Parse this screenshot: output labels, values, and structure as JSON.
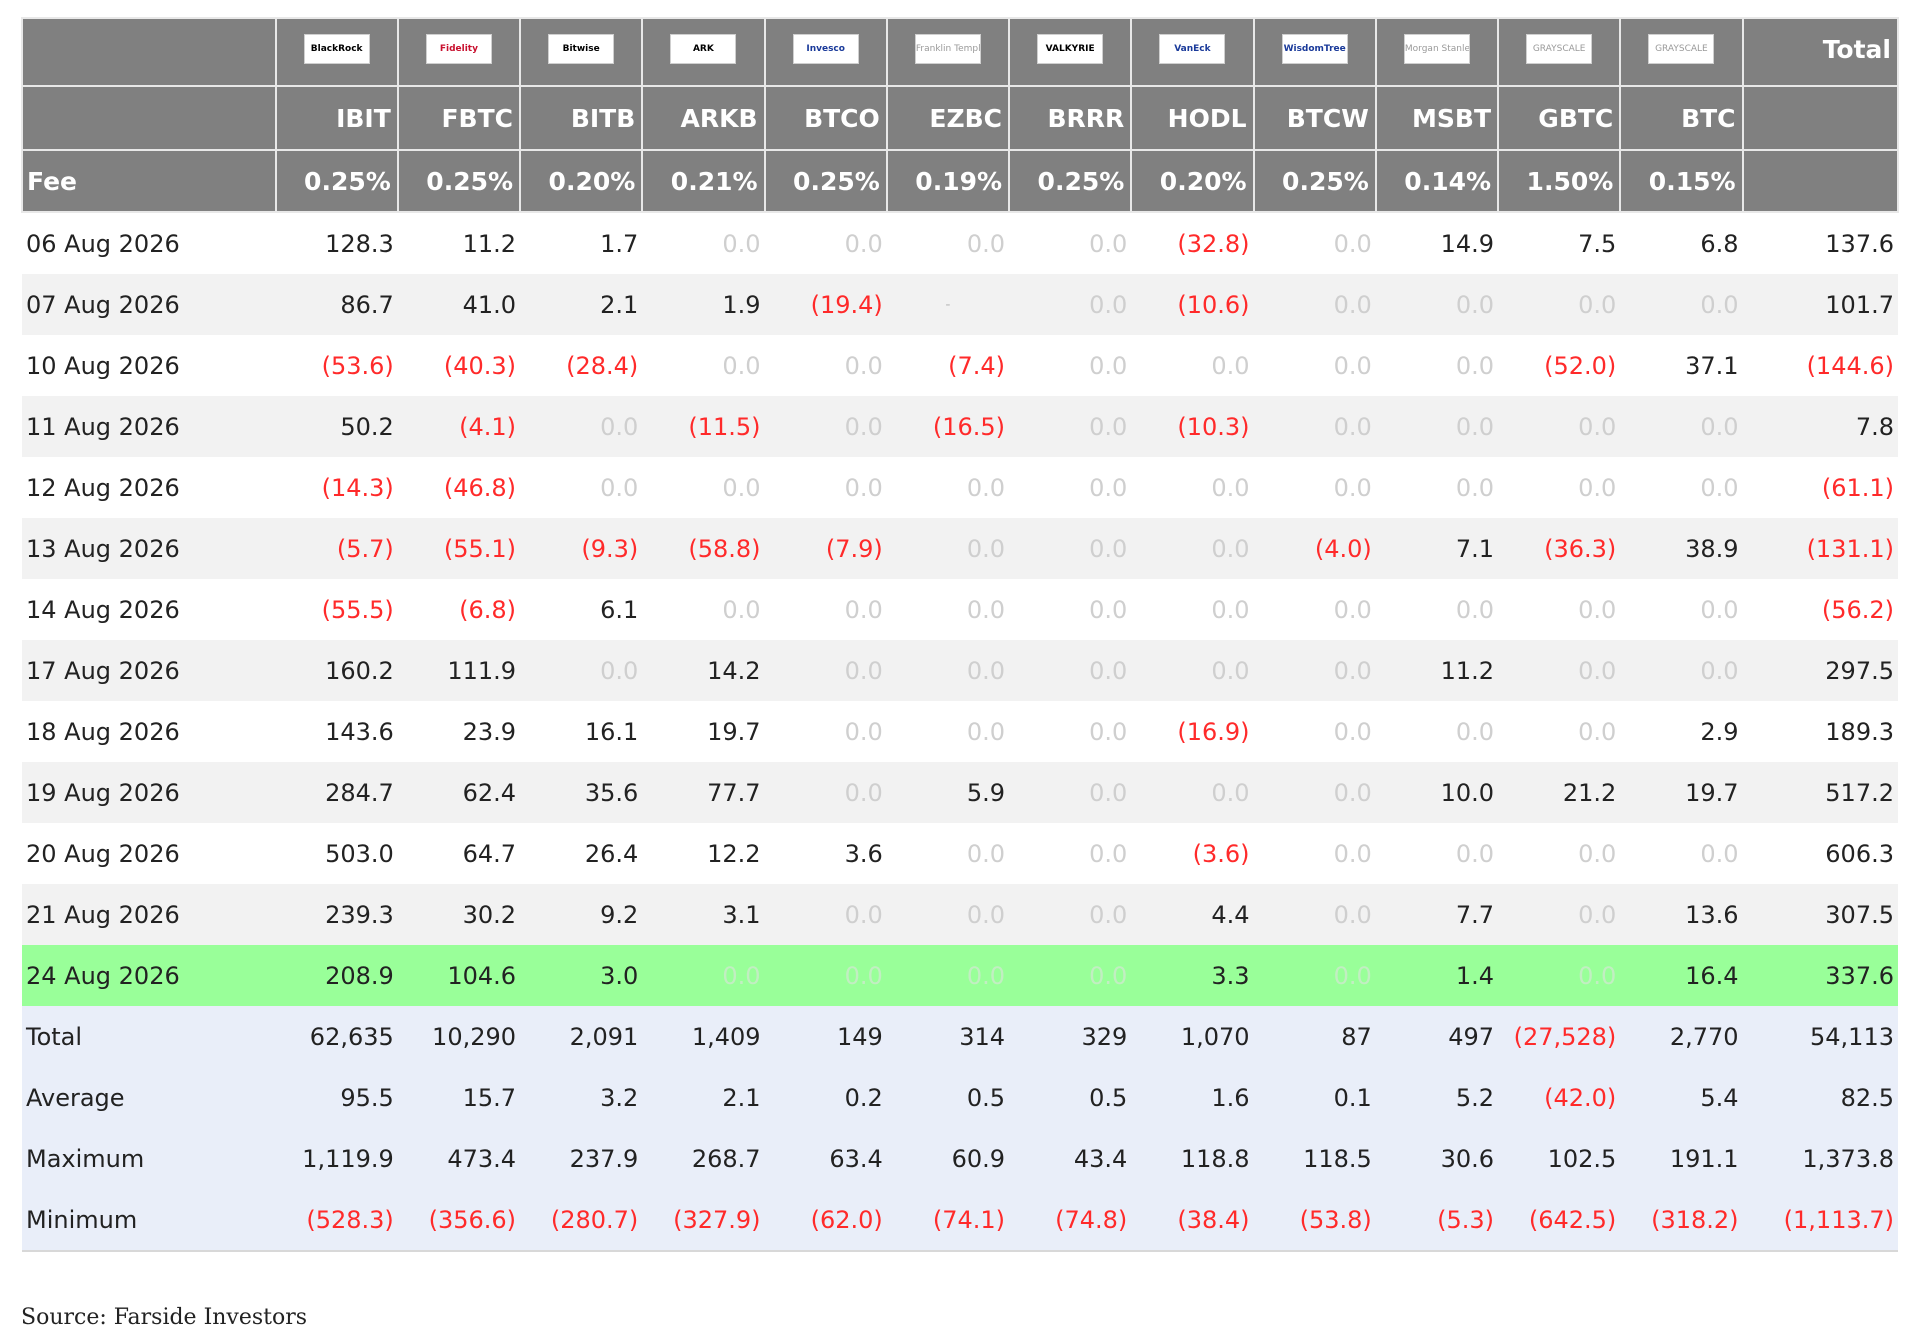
{
  "header": {
    "total_label": "Total",
    "fee_label": "Fee",
    "funds": [
      {
        "ticker": "IBIT",
        "fee": "0.25%",
        "logo_text": "BlackRock",
        "logo_icon": "blackrock-logo"
      },
      {
        "ticker": "FBTC",
        "fee": "0.25%",
        "logo_text": "Fidelity",
        "logo_icon": "fidelity-logo"
      },
      {
        "ticker": "BITB",
        "fee": "0.20%",
        "logo_text": "Bitwise",
        "logo_icon": "bitwise-logo"
      },
      {
        "ticker": "ARKB",
        "fee": "0.21%",
        "logo_text": "ARK",
        "logo_icon": "ark-logo"
      },
      {
        "ticker": "BTCO",
        "fee": "0.25%",
        "logo_text": "Invesco",
        "logo_icon": "invesco-logo"
      },
      {
        "ticker": "EZBC",
        "fee": "0.19%",
        "logo_text": "Franklin Templeton",
        "logo_icon": "franklin-logo"
      },
      {
        "ticker": "BRRR",
        "fee": "0.25%",
        "logo_text": "VALKYRIE",
        "logo_icon": "valkyrie-logo"
      },
      {
        "ticker": "HODL",
        "fee": "0.20%",
        "logo_text": "VanEck",
        "logo_icon": "vaneck-logo"
      },
      {
        "ticker": "BTCW",
        "fee": "0.25%",
        "logo_text": "WisdomTree",
        "logo_icon": "wisdomtree-logo"
      },
      {
        "ticker": "MSBT",
        "fee": "0.14%",
        "logo_text": "Morgan Stanley",
        "logo_icon": "morgan-stanley-logo"
      },
      {
        "ticker": "GBTC",
        "fee": "1.50%",
        "logo_text": "GRAYSCALE",
        "logo_icon": "grayscale-logo"
      },
      {
        "ticker": "BTC",
        "fee": "0.15%",
        "logo_text": "GRAYSCALE",
        "logo_icon": "grayscale-logo"
      }
    ]
  },
  "rows": [
    {
      "date": "06 Aug 2026",
      "values": [
        "128.3",
        "11.2",
        "1.7",
        "0.0",
        "0.0",
        "0.0",
        "0.0",
        "(32.8)",
        "0.0",
        "14.9",
        "7.5",
        "6.8"
      ],
      "total": "137.6"
    },
    {
      "date": "07 Aug 2026",
      "values": [
        "86.7",
        "41.0",
        "2.1",
        "1.9",
        "(19.4)",
        "-",
        "0.0",
        "(10.6)",
        "0.0",
        "0.0",
        "0.0",
        "0.0"
      ],
      "total": "101.7"
    },
    {
      "date": "10 Aug 2026",
      "values": [
        "(53.6)",
        "(40.3)",
        "(28.4)",
        "0.0",
        "0.0",
        "(7.4)",
        "0.0",
        "0.0",
        "0.0",
        "0.0",
        "(52.0)",
        "37.1"
      ],
      "total": "(144.6)"
    },
    {
      "date": "11 Aug 2026",
      "values": [
        "50.2",
        "(4.1)",
        "0.0",
        "(11.5)",
        "0.0",
        "(16.5)",
        "0.0",
        "(10.3)",
        "0.0",
        "0.0",
        "0.0",
        "0.0"
      ],
      "total": "7.8"
    },
    {
      "date": "12 Aug 2026",
      "values": [
        "(14.3)",
        "(46.8)",
        "0.0",
        "0.0",
        "0.0",
        "0.0",
        "0.0",
        "0.0",
        "0.0",
        "0.0",
        "0.0",
        "0.0"
      ],
      "total": "(61.1)"
    },
    {
      "date": "13 Aug 2026",
      "values": [
        "(5.7)",
        "(55.1)",
        "(9.3)",
        "(58.8)",
        "(7.9)",
        "0.0",
        "0.0",
        "0.0",
        "(4.0)",
        "7.1",
        "(36.3)",
        "38.9"
      ],
      "total": "(131.1)"
    },
    {
      "date": "14 Aug 2026",
      "values": [
        "(55.5)",
        "(6.8)",
        "6.1",
        "0.0",
        "0.0",
        "0.0",
        "0.0",
        "0.0",
        "0.0",
        "0.0",
        "0.0",
        "0.0"
      ],
      "total": "(56.2)"
    },
    {
      "date": "17 Aug 2026",
      "values": [
        "160.2",
        "111.9",
        "0.0",
        "14.2",
        "0.0",
        "0.0",
        "0.0",
        "0.0",
        "0.0",
        "11.2",
        "0.0",
        "0.0"
      ],
      "total": "297.5"
    },
    {
      "date": "18 Aug 2026",
      "values": [
        "143.6",
        "23.9",
        "16.1",
        "19.7",
        "0.0",
        "0.0",
        "0.0",
        "(16.9)",
        "0.0",
        "0.0",
        "0.0",
        "2.9"
      ],
      "total": "189.3"
    },
    {
      "date": "19 Aug 2026",
      "values": [
        "284.7",
        "62.4",
        "35.6",
        "77.7",
        "0.0",
        "5.9",
        "0.0",
        "0.0",
        "0.0",
        "10.0",
        "21.2",
        "19.7"
      ],
      "total": "517.2"
    },
    {
      "date": "20 Aug 2026",
      "values": [
        "503.0",
        "64.7",
        "26.4",
        "12.2",
        "3.6",
        "0.0",
        "0.0",
        "(3.6)",
        "0.0",
        "0.0",
        "0.0",
        "0.0"
      ],
      "total": "606.3"
    },
    {
      "date": "21 Aug 2026",
      "values": [
        "239.3",
        "30.2",
        "9.2",
        "3.1",
        "0.0",
        "0.0",
        "0.0",
        "4.4",
        "0.0",
        "7.7",
        "0.0",
        "13.6"
      ],
      "total": "307.5"
    },
    {
      "date": "24 Aug 2026",
      "values": [
        "208.9",
        "104.6",
        "3.0",
        "0.0",
        "0.0",
        "0.0",
        "0.0",
        "3.3",
        "0.0",
        "1.4",
        "0.0",
        "16.4"
      ],
      "total": "337.6",
      "highlight": true
    }
  ],
  "summary": [
    {
      "label": "Total",
      "values": [
        "62,635",
        "10,290",
        "2,091",
        "1,409",
        "149",
        "314",
        "329",
        "1,070",
        "87",
        "497",
        "(27,528)",
        "2,770"
      ],
      "total": "54,113"
    },
    {
      "label": "Average",
      "values": [
        "95.5",
        "15.7",
        "3.2",
        "2.1",
        "0.2",
        "0.5",
        "0.5",
        "1.6",
        "0.1",
        "5.2",
        "(42.0)",
        "5.4"
      ],
      "total": "82.5"
    },
    {
      "label": "Maximum",
      "values": [
        "1,119.9",
        "473.4",
        "237.9",
        "268.7",
        "63.4",
        "60.9",
        "43.4",
        "118.8",
        "118.5",
        "30.6",
        "102.5",
        "191.1"
      ],
      "total": "1,373.8"
    },
    {
      "label": "Minimum",
      "values": [
        "(528.3)",
        "(356.6)",
        "(280.7)",
        "(327.9)",
        "(62.0)",
        "(74.1)",
        "(74.8)",
        "(38.4)",
        "(53.8)",
        "(5.3)",
        "(642.5)",
        "(318.2)"
      ],
      "total": "(1,113.7)"
    }
  ],
  "colors": {
    "header_bg": "#808080",
    "negative": "#ff2a2a",
    "zero": "#cfcfcf",
    "highlight_row": "#99ff99",
    "summary_bg": "#e9eef9"
  },
  "source_text": "Source: Farside Investors"
}
